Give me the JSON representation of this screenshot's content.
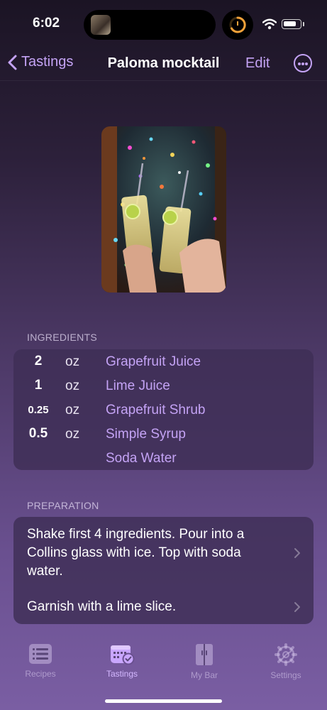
{
  "status": {
    "time": "6:02",
    "battery_level": 0.8
  },
  "nav": {
    "back_label": "Tastings",
    "title": "Paloma mocktail",
    "edit_label": "Edit"
  },
  "ingredients": {
    "header": "INGREDIENTS",
    "items": [
      {
        "qty": "2",
        "unit": "oz",
        "name": "Grapefruit Juice"
      },
      {
        "qty": "1",
        "unit": "oz",
        "name": "Lime Juice"
      },
      {
        "qty": "0.25",
        "unit": "oz",
        "name": "Grapefruit Shrub"
      },
      {
        "qty": "0.5",
        "unit": "oz",
        "name": "Simple Syrup"
      },
      {
        "qty": "",
        "unit": "",
        "name": "Soda Water"
      }
    ]
  },
  "preparation": {
    "header": "PREPARATION",
    "steps": [
      "Shake first 4 ingredients. Pour into a Collins glass with ice. Top with soda water.",
      "Garnish with a lime slice."
    ]
  },
  "tabs": [
    {
      "label": "Recipes",
      "icon": "list-icon",
      "active": false
    },
    {
      "label": "Tastings",
      "icon": "calendar-check-icon",
      "active": true
    },
    {
      "label": "My Bar",
      "icon": "cabinet-icon",
      "active": false
    },
    {
      "label": "Settings",
      "icon": "gear-icon",
      "active": false
    }
  ],
  "colors": {
    "accent": "#c4a3f5",
    "card": "#3e2e56",
    "text": "#ffffff"
  }
}
